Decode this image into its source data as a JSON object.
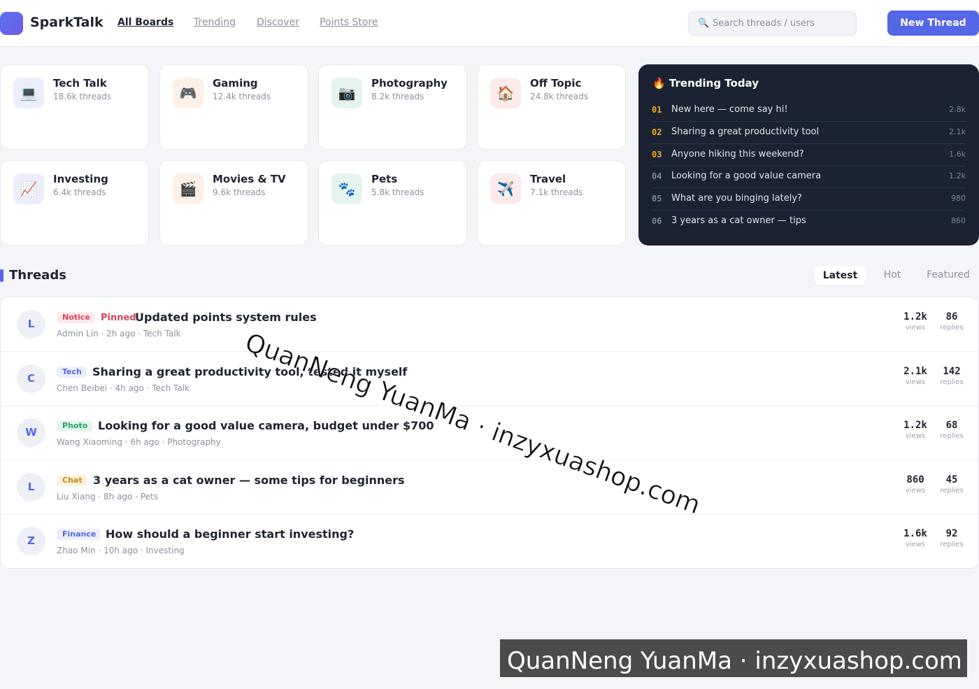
{
  "header": {
    "brand": "SparkTalk",
    "nav": [
      "All Boards",
      "Trending",
      "Discover",
      "Points Store"
    ],
    "search_placeholder": "Search threads / users",
    "new_thread_label": "New Thread"
  },
  "boards": [
    {
      "name": "Tech Talk",
      "count": "18.6k threads",
      "icon": "💻",
      "icon_name": "laptop-icon",
      "bg": "#eceefb"
    },
    {
      "name": "Gaming",
      "count": "12.4k threads",
      "icon": "🎮",
      "icon_name": "gamepad-icon",
      "bg": "#fdf0e6"
    },
    {
      "name": "Photography",
      "count": "8.2k threads",
      "icon": "📷",
      "icon_name": "camera-icon",
      "bg": "#e5f4ef"
    },
    {
      "name": "Off Topic",
      "count": "24.8k threads",
      "icon": "🏠",
      "icon_name": "house-icon",
      "bg": "#fdeaea"
    },
    {
      "name": "Investing",
      "count": "6.4k threads",
      "icon": "📈",
      "icon_name": "chart-up-icon",
      "bg": "#eceefb"
    },
    {
      "name": "Movies & TV",
      "count": "9.6k threads",
      "icon": "🎬",
      "icon_name": "clapperboard-icon",
      "bg": "#fdf0e6"
    },
    {
      "name": "Pets",
      "count": "5.8k threads",
      "icon": "🐾",
      "icon_name": "paw-icon",
      "bg": "#e5f4ef"
    },
    {
      "name": "Travel",
      "count": "7.1k threads",
      "icon": "✈️",
      "icon_name": "airplane-icon",
      "bg": "#fdeaea"
    }
  ],
  "trending": {
    "title": "Trending Today",
    "icon": "🔥",
    "items": [
      {
        "rank": "01",
        "title": "New here — come say hi!",
        "views": "2.8k",
        "rank_color": "#f5a623"
      },
      {
        "rank": "02",
        "title": "Sharing a great productivity tool",
        "views": "2.1k",
        "rank_color": "#f5a623"
      },
      {
        "rank": "03",
        "title": "Anyone hiking this weekend?",
        "views": "1.6k",
        "rank_color": "#f5a623"
      },
      {
        "rank": "04",
        "title": "Looking for a good value camera",
        "views": "1.2k",
        "rank_color": "#7c8597"
      },
      {
        "rank": "05",
        "title": "What are you binging lately?",
        "views": "980",
        "rank_color": "#7c8597"
      },
      {
        "rank": "06",
        "title": "3 years as a cat owner — tips",
        "views": "860",
        "rank_color": "#7c8597"
      }
    ]
  },
  "threads_section": {
    "title": "Threads",
    "tabs": [
      "Latest",
      "Hot",
      "Featured"
    ],
    "active_tab": "Latest"
  },
  "threads": [
    {
      "avatar": "L",
      "tag": "Notice",
      "tag_class": "tag-notice",
      "pinned": "Pinned",
      "title": "Updated points system rules",
      "meta": "Admin Lin · 2h ago · Tech Talk",
      "views": "1.2k",
      "replies": "86"
    },
    {
      "avatar": "C",
      "tag": "Tech",
      "tag_class": "tag-tech",
      "pinned": "",
      "title": "Sharing a great productivity tool, tested it myself",
      "meta": "Chen Beibei · 4h ago · Tech Talk",
      "views": "2.1k",
      "replies": "142"
    },
    {
      "avatar": "W",
      "tag": "Photo",
      "tag_class": "tag-photo",
      "pinned": "",
      "title": "Looking for a good value camera, budget under $700",
      "meta": "Wang Xiaoming · 6h ago · Photography",
      "views": "1.2k",
      "replies": "68"
    },
    {
      "avatar": "L",
      "tag": "Chat",
      "tag_class": "tag-chat",
      "pinned": "",
      "title": "3 years as a cat owner — some tips for beginners",
      "meta": "Liu Xiang · 8h ago · Pets",
      "views": "860",
      "replies": "45"
    },
    {
      "avatar": "Z",
      "tag": "Finance",
      "tag_class": "tag-finance",
      "pinned": "",
      "title": "How should a beginner start investing?",
      "meta": "Zhao Min · 10h ago · Investing",
      "views": "1.6k",
      "replies": "92"
    }
  ],
  "stat_labels": {
    "views": "views",
    "replies": "replies"
  },
  "watermark": {
    "text": "QuanNeng YuanMa · inzyxuashop.com"
  }
}
